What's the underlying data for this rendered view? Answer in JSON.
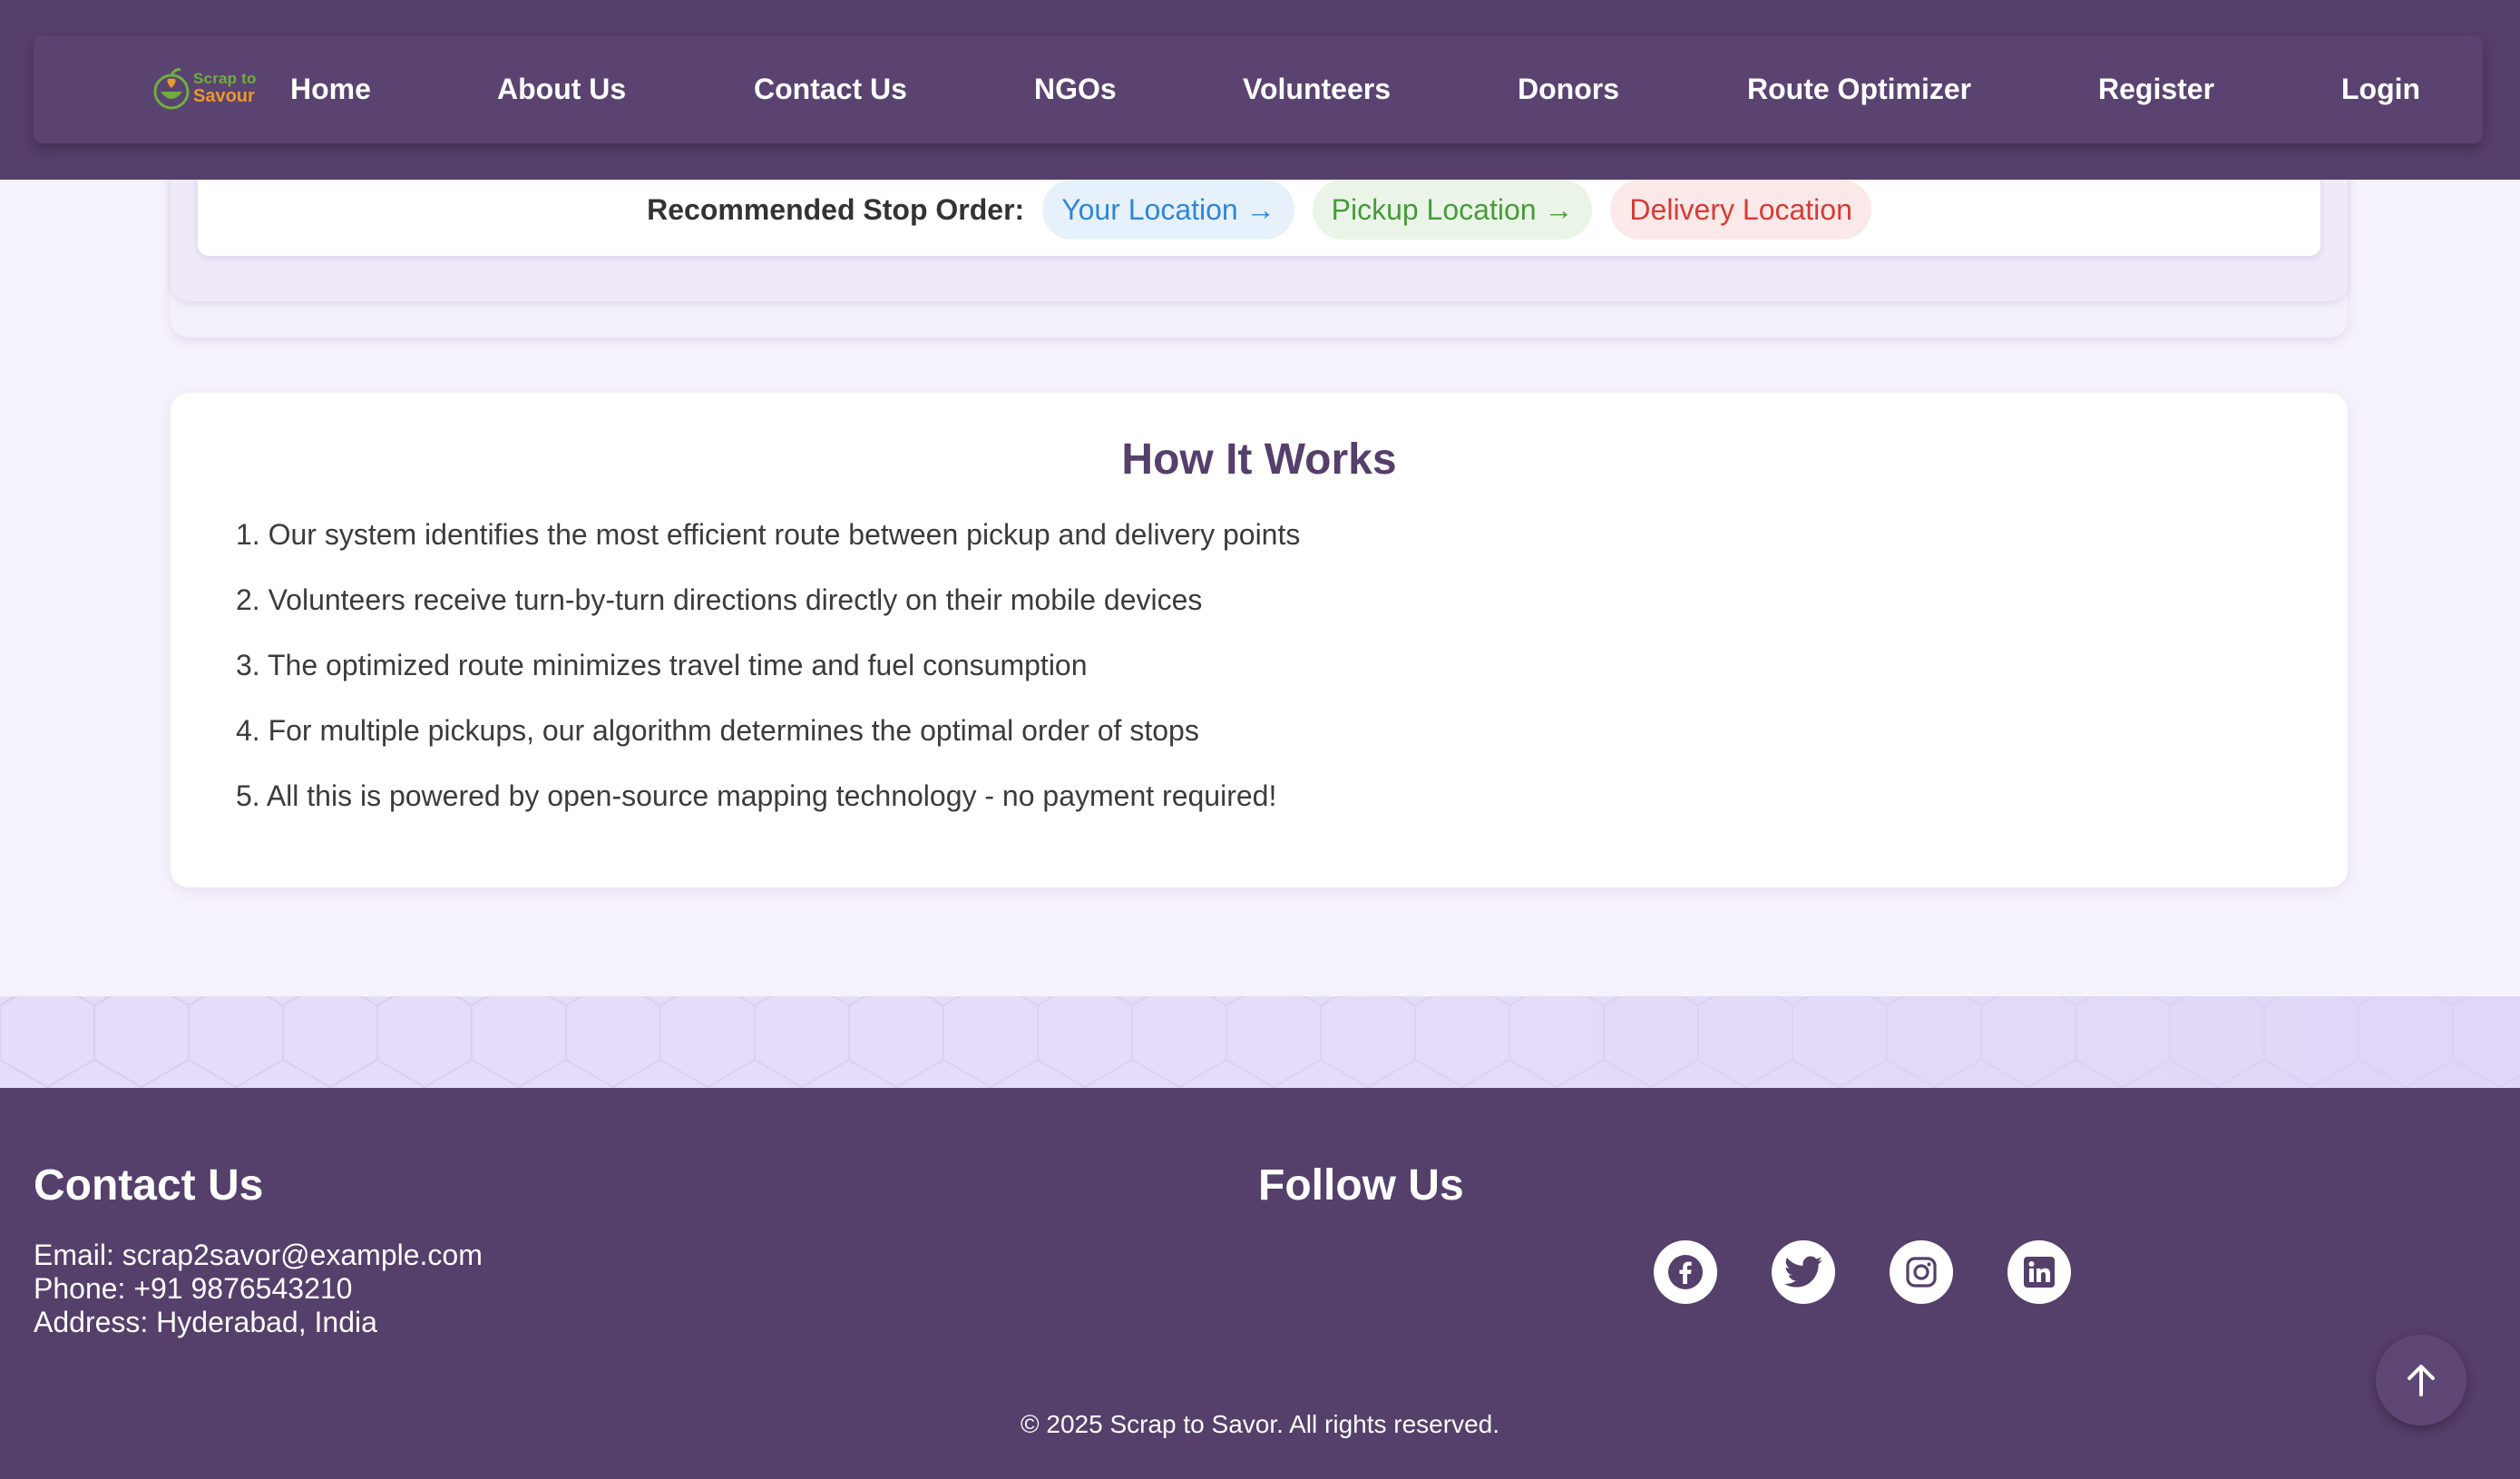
{
  "logo": {
    "line1": "Scrap to",
    "line2": "Savour",
    "colors": {
      "line1": "#6fae3e",
      "line2": "#e89a2d"
    }
  },
  "nav": {
    "items": [
      {
        "label": "Home"
      },
      {
        "label": "About Us"
      },
      {
        "label": "Contact Us"
      },
      {
        "label": "NGOs"
      },
      {
        "label": "Volunteers"
      },
      {
        "label": "Donors"
      },
      {
        "label": "Route Optimizer"
      },
      {
        "label": "Register"
      },
      {
        "label": "Login"
      }
    ]
  },
  "route": {
    "stop_order_label": "Recommended Stop Order:",
    "stops": [
      "Your Location →",
      "Pickup Location →",
      "Delivery Location"
    ]
  },
  "how_it_works": {
    "title": "How It Works",
    "steps": [
      "1. Our system identifies the most efficient route between pickup and delivery points",
      "2. Volunteers receive turn-by-turn directions directly on their mobile devices",
      "3. The optimized route minimizes travel time and fuel consumption",
      "4. For multiple pickups, our algorithm determines the optimal order of stops",
      "5. All this is powered by open-source mapping technology - no payment required!"
    ]
  },
  "footer": {
    "contact_heading": "Contact Us",
    "email": "Email: scrap2savor@example.com",
    "phone": "Phone: +91 9876543210",
    "address": "Address: Hyderabad, India",
    "follow_heading": "Follow Us",
    "social_icons": [
      "facebook-icon",
      "twitter-icon",
      "instagram-icon",
      "linkedin-icon"
    ],
    "copyright": "© 2025 Scrap to Savor. All rights reserved."
  },
  "colors": {
    "brand_purple": "#553f6b",
    "page_bg": "#f6f2fc",
    "stop_blue": "#2f86d7",
    "stop_green": "#479b3b",
    "stop_red": "#d83a35"
  }
}
